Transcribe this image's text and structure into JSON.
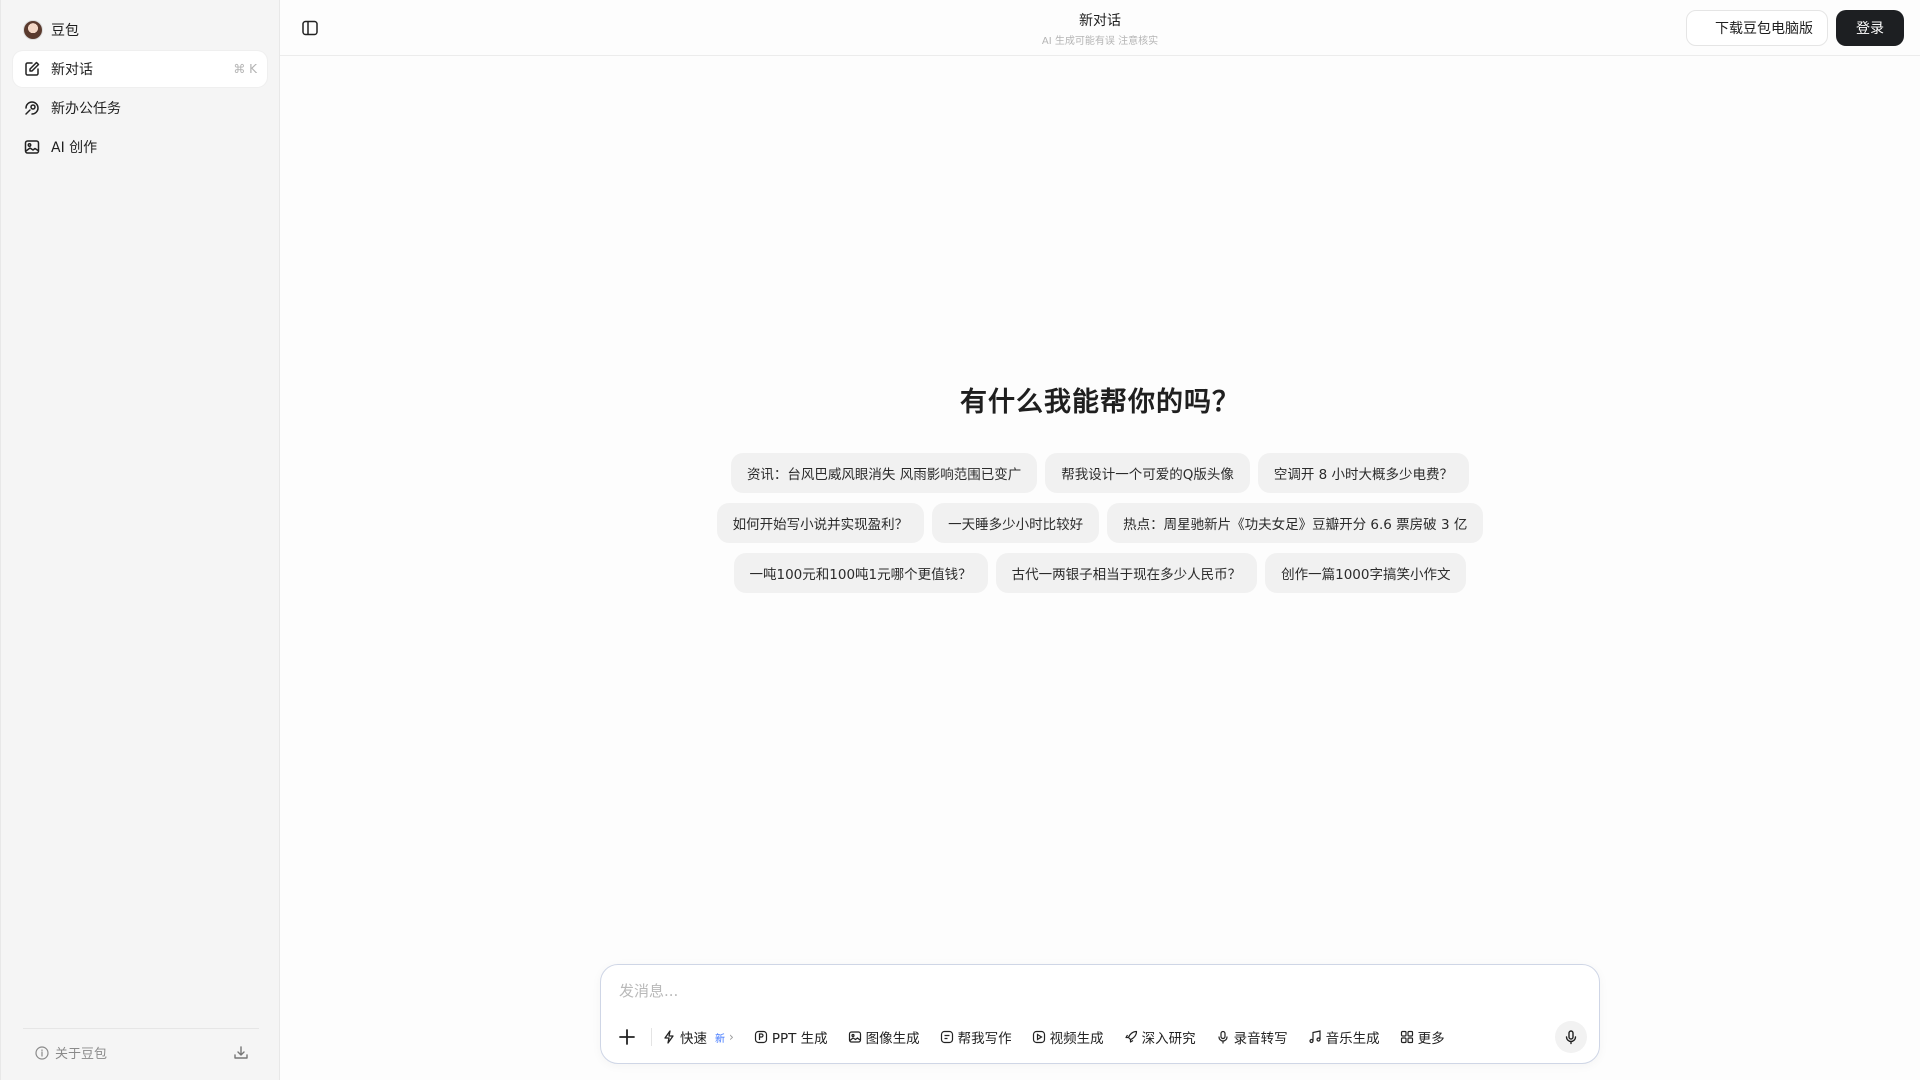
{
  "sidebar": {
    "brand": "豆包",
    "items": [
      {
        "label": "新对话",
        "shortcut": "⌘ K",
        "icon": "edit-icon"
      },
      {
        "label": "新办公任务",
        "icon": "office-task-icon"
      },
      {
        "label": "AI 创作",
        "icon": "image-create-icon"
      }
    ],
    "footer": {
      "about": "关于豆包"
    }
  },
  "header": {
    "title": "新对话",
    "subtitle": "AI 生成可能有误 注意核实",
    "download_label": "下载豆包电脑版",
    "login_label": "登录"
  },
  "main": {
    "heading": "有什么我能帮你的吗？",
    "suggestions": [
      [
        "资讯：台风巴威风眼消失 风雨影响范围已变广",
        "帮我设计一个可爱的Q版头像",
        "空调开 8 小时大概多少电费？"
      ],
      [
        "如何开始写小说并实现盈利？",
        "一天睡多少小时比较好",
        "热点：周星驰新片《功夫女足》豆瓣开分 6.6 票房破 3 亿"
      ],
      [
        "一吨100元和100吨1元哪个更值钱？",
        "古代一两银子相当于现在多少人民币？",
        "创作一篇1000字搞笑小作文"
      ]
    ]
  },
  "composer": {
    "placeholder": "发消息...",
    "mode": {
      "label": "快速",
      "badge": "新"
    },
    "tools": [
      "PPT 生成",
      "图像生成",
      "帮我写作",
      "视频生成",
      "深入研究",
      "录音转写",
      "音乐生成",
      "更多"
    ]
  }
}
